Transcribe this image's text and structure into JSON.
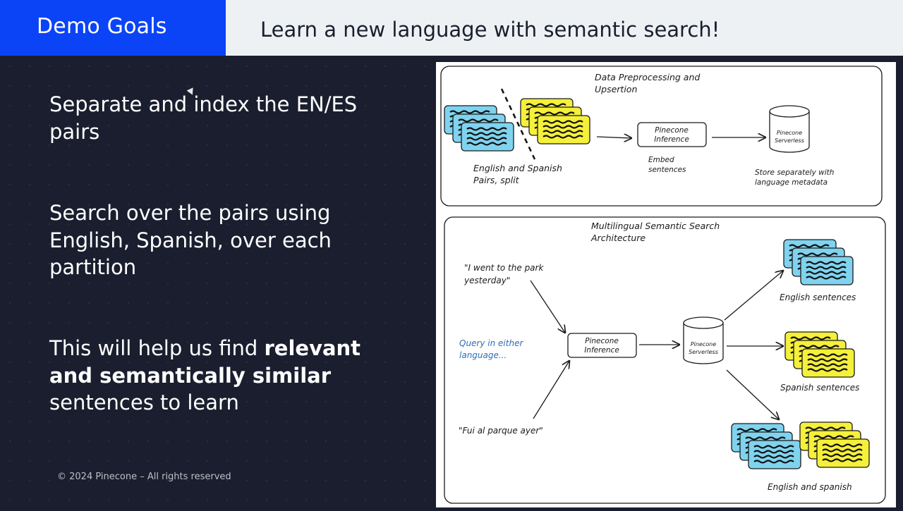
{
  "header": {
    "section_title": "Demo Goals",
    "slide_title": "Learn a new language with semantic search!"
  },
  "points": [
    {
      "text": "Separate and index the EN/ES pairs"
    },
    {
      "text": "Search over the pairs using English, Spanish, over each partition"
    },
    {
      "text_before": "This will help us find ",
      "bold": "relevant and semantically similar",
      "text_after": " sentences to learn"
    }
  ],
  "footer": "© 2024 Pinecone – All rights reserved",
  "diagram": {
    "top": {
      "title_line1": "Data Preprocessing and",
      "title_line2": "Upsertion",
      "pairs_label_line1": "English and Spanish",
      "pairs_label_line2": "Pairs, split",
      "inference_line1": "Pinecone",
      "inference_line2": "Inference",
      "embed_line1": "Embed",
      "embed_line2": "sentences",
      "serverless_line1": "Pinecone",
      "serverless_line2": "Serverless",
      "store_line1": "Store separately with",
      "store_line2": "language metadata"
    },
    "bottom": {
      "title_line1": "Multilingual Semantic Search",
      "title_line2": "Architecture",
      "query_en_line1": "\"I went to the park",
      "query_en_line2": "yesterday\"",
      "query_either_line1": "Query in either",
      "query_either_line2": "language...",
      "query_es": "\"Fui al parque ayer\"",
      "inference_line1": "Pinecone",
      "inference_line2": "Inference",
      "serverless_line1": "Pinecone",
      "serverless_line2": "Serverless",
      "english_label": "English sentences",
      "spanish_label": "Spanish sentences",
      "both_label": "English and spanish"
    },
    "colors": {
      "english_cards": "#7fd3ef",
      "spanish_cards": "#f5f03a",
      "query_text": "#2e6fb8"
    }
  }
}
